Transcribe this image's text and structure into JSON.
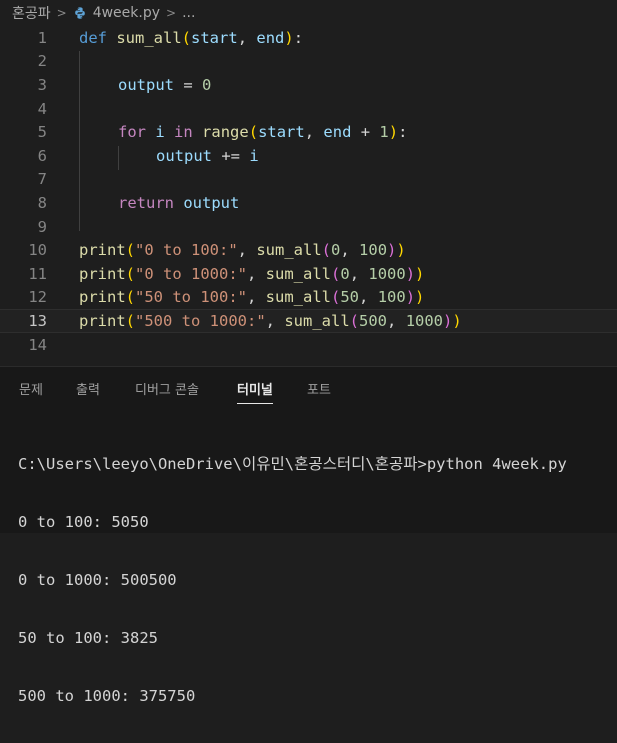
{
  "breadcrumb": {
    "folder": "혼공파",
    "sep1": ">",
    "file": "4week.py",
    "sep2": ">",
    "ellipsis": "..."
  },
  "editor": {
    "line_numbers": [
      "1",
      "2",
      "3",
      "4",
      "5",
      "6",
      "7",
      "8",
      "9",
      "10",
      "11",
      "12",
      "13",
      "14"
    ],
    "active_line": "13",
    "tokens": {
      "def": "def",
      "sum_all": "sum_all",
      "lp": "(",
      "rp": ")",
      "start": "start",
      "end": "end",
      "comma": ", ",
      "colon": ":",
      "output": "output",
      "eq": " = ",
      "zero": "0",
      "for": "for",
      "i": "i",
      "in": "in",
      "range": "range",
      "plus": " + ",
      "one": "1",
      "pluseq": " += ",
      "return": "return",
      "print": "print",
      "comma_sp": ", ",
      "s10": "\"0 to 100:\"",
      "s11": "\"0 to 1000:\"",
      "s12": "\"50 to 100:\"",
      "s13": "\"500 to 1000:\"",
      "n0": "0",
      "n50": "50",
      "n500": "500",
      "n100": "100",
      "n1000": "1000"
    }
  },
  "panel": {
    "tabs": [
      "문제",
      "출력",
      "디버그 콘솔",
      "터미널",
      "포트"
    ],
    "active_tab": "터미널",
    "terminal": [
      "C:\\Users\\leeyo\\OneDrive\\이유민\\혼공스터디\\혼공파>python 4week.py",
      "0 to 100: 5050",
      "0 to 1000: 500500",
      "50 to 100: 3825",
      "500 to 1000: 375750"
    ]
  },
  "colors": {
    "background": "#1e1e1e",
    "keyword": "#569cd6",
    "control": "#c586c0",
    "function": "#dcdcaa",
    "variable": "#9cdcfe",
    "number": "#b5cea8",
    "string": "#ce9178"
  }
}
